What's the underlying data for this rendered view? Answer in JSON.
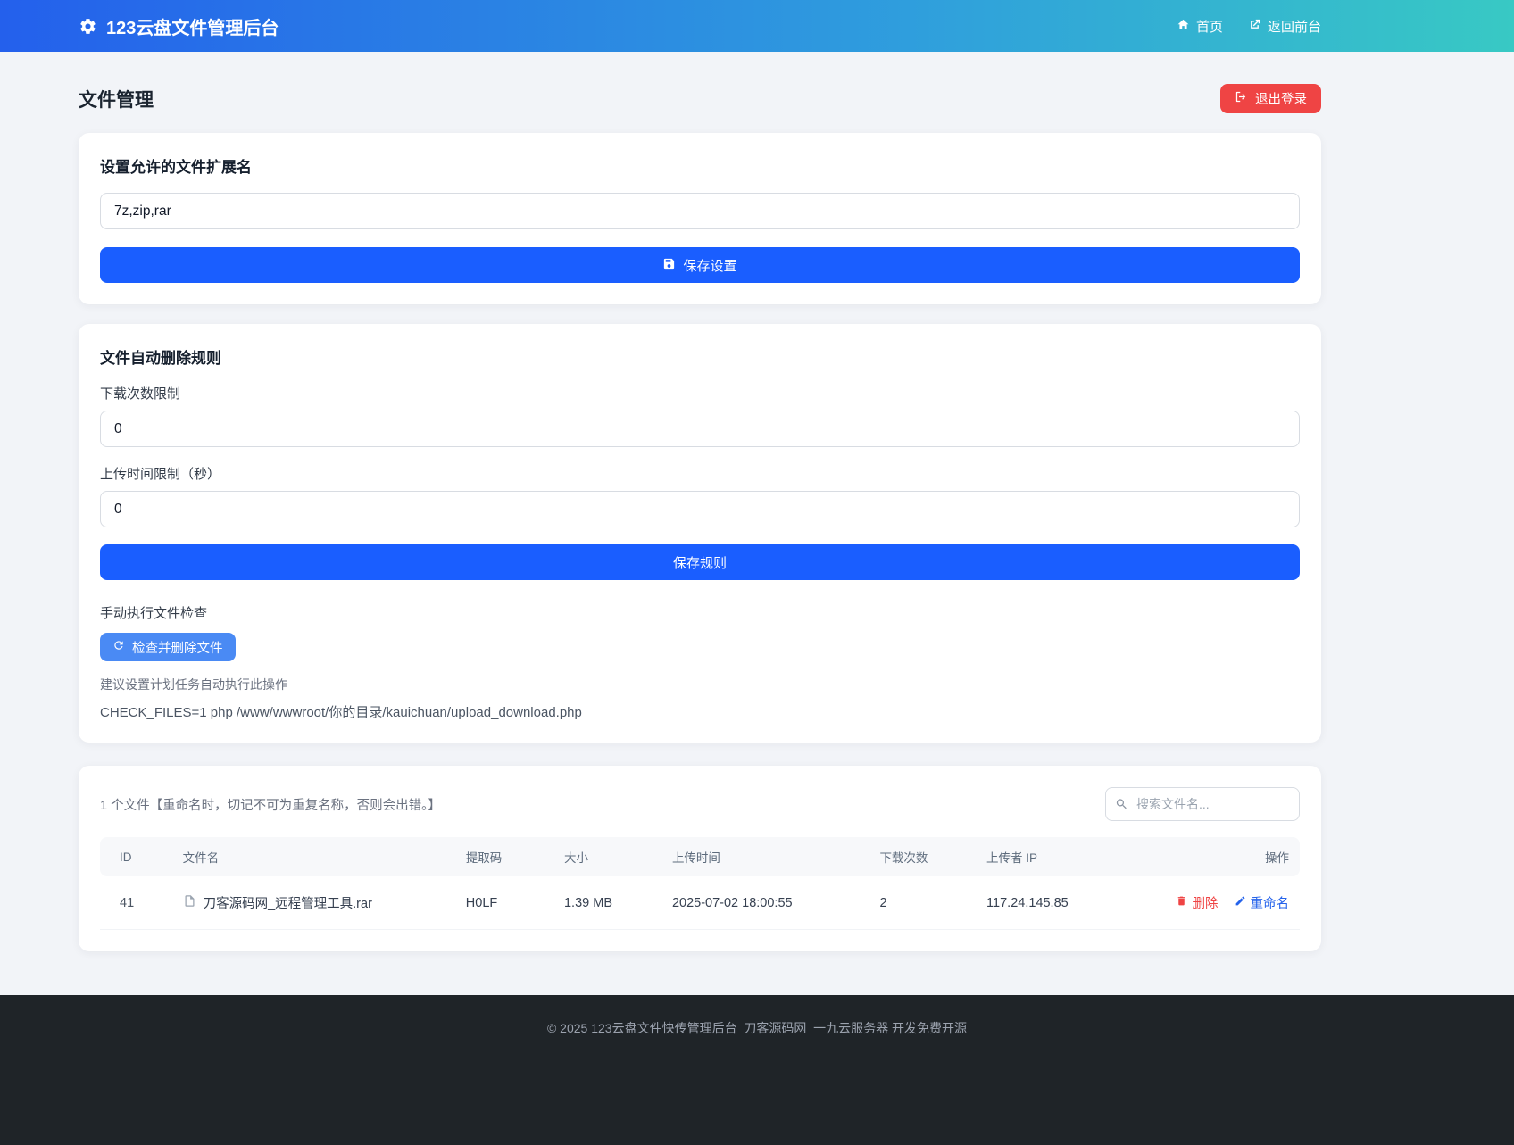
{
  "navbar": {
    "title": "123云盘文件管理后台",
    "links": [
      {
        "label": "首页"
      },
      {
        "label": "返回前台"
      }
    ]
  },
  "header": {
    "page_title": "文件管理",
    "logout_label": "退出登录"
  },
  "ext_card": {
    "title": "设置允许的文件扩展名",
    "input_value": "7z,zip,rar",
    "save_label": "保存设置"
  },
  "rules_card": {
    "title": "文件自动删除规则",
    "download_limit_label": "下载次数限制",
    "download_limit_value": "0",
    "upload_time_label": "上传时间限制（秒）",
    "upload_time_value": "0",
    "save_label": "保存规则",
    "manual_check_label": "手动执行文件检查",
    "check_button_label": "检查并删除文件",
    "hint": "建议设置计划任务自动执行此操作",
    "command": "CHECK_FILES=1 php /www/wwwroot/你的目录/kauichuan/upload_download.php"
  },
  "files_card": {
    "summary": "1 个文件【重命名时，切记不可为重复名称，否则会出错。】",
    "search_placeholder": "搜索文件名...",
    "table": {
      "headers": [
        "ID",
        "文件名",
        "提取码",
        "大小",
        "上传时间",
        "下载次数",
        "上传者 IP",
        "操作"
      ],
      "rows": [
        {
          "id": "41",
          "name": "刀客源码网_远程管理工具.rar",
          "code": "H0LF",
          "size": "1.39 MB",
          "time": "2025-07-02 18:00:55",
          "downloads": "2",
          "ip": "117.24.145.85",
          "delete_label": "删除",
          "rename_label": "重命名"
        }
      ]
    }
  },
  "footer": {
    "text": "© 2025 123云盘文件快传管理后台  刀客源码网  一九云服务器 开发免费开源"
  },
  "colors": {
    "navbar_gradient_start": "#2460ec",
    "navbar_gradient_end": "#38c9c4",
    "primary_button": "#1a5eff",
    "check_button": "#4a8af4",
    "danger": "#ef4444",
    "link_blue": "#2563eb",
    "footer_bg": "#1f2428"
  }
}
